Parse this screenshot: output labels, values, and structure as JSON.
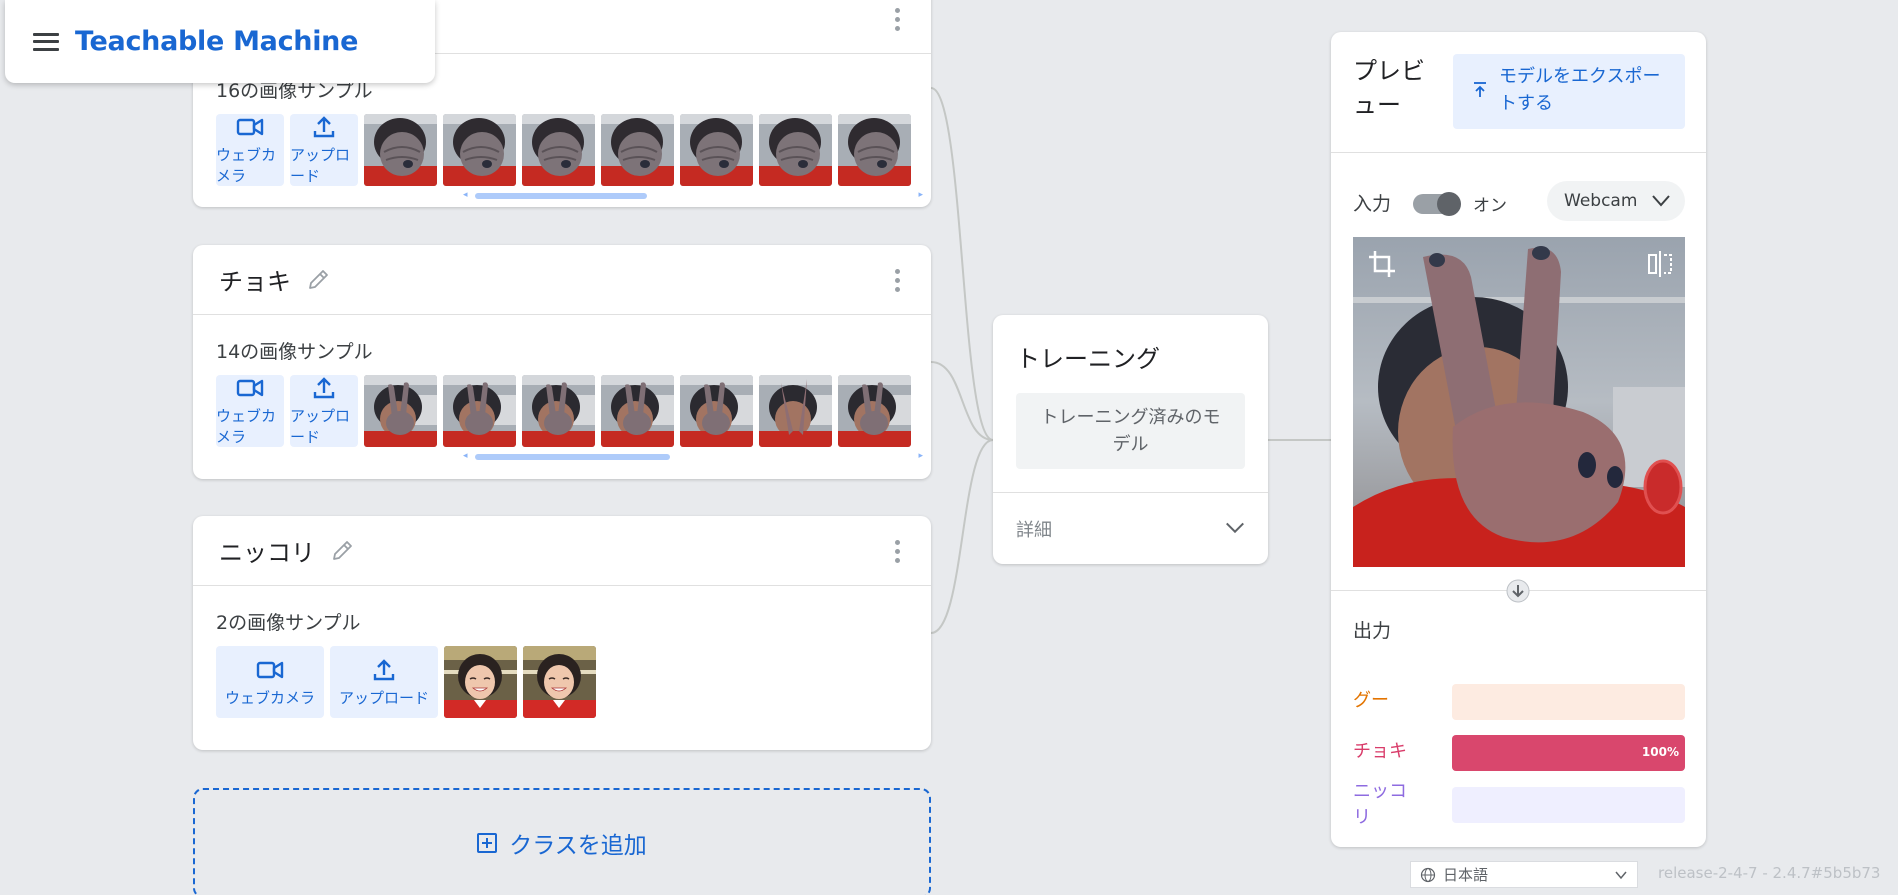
{
  "app": {
    "title": "Teachable Machine"
  },
  "classes": [
    {
      "name": "",
      "sample_count": "16の画像サンプル",
      "thumb_type": "fist",
      "thumb_count": 7,
      "scroll_fraction": 0.44
    },
    {
      "name": "チョキ",
      "sample_count": "14の画像サンプル",
      "thumb_type": "peace",
      "thumb_count": 7,
      "scroll_fraction": 0.5
    },
    {
      "name": "ニッコリ",
      "sample_count": "2の画像サンプル",
      "thumb_type": "smile",
      "thumb_count": 2,
      "scroll_fraction": null
    }
  ],
  "source_buttons": {
    "webcam": "ウェブカメラ",
    "upload": "アップロード"
  },
  "add_class_label": "クラスを追加",
  "training": {
    "title": "トレーニング",
    "button_label": "トレーニング済みのモデル",
    "advanced_label": "詳細"
  },
  "preview": {
    "title": "プレビュー",
    "export_label": "モデルをエクスポートする",
    "input_label": "入力",
    "input_state": "オン",
    "input_on": true,
    "webcam_option": "Webcam",
    "output_label": "出力",
    "outputs": [
      {
        "name": "グー",
        "fraction": 0.0,
        "label": "",
        "text_color": "#e37400",
        "bar_bg": "#fdebe1",
        "fill_color": "#f8a66b"
      },
      {
        "name": "チョキ",
        "fraction": 1.0,
        "label": "100%",
        "text_color": "#d93c6a",
        "bar_bg": "#fbe2ea",
        "fill_color": "#d9476d"
      },
      {
        "name": "ニッコリ",
        "fraction": 0.0,
        "label": "",
        "text_color": "#8e6be0",
        "bar_bg": "#efefff",
        "fill_color": "#a08df0"
      }
    ]
  },
  "footer": {
    "language": "日本語",
    "version": "release-2-4-7 - 2.4.7#5b5b73"
  },
  "colors": {
    "brand": "#1967d2",
    "background": "#e8eaed"
  },
  "icons": [
    "menu-icon",
    "pencil-icon",
    "more-vert-icon",
    "videocam-icon",
    "upload-icon",
    "crop-icon",
    "flip-icon",
    "arrow-down-icon",
    "globe-icon",
    "chevron-down-icon",
    "export-icon",
    "add-box-icon"
  ]
}
